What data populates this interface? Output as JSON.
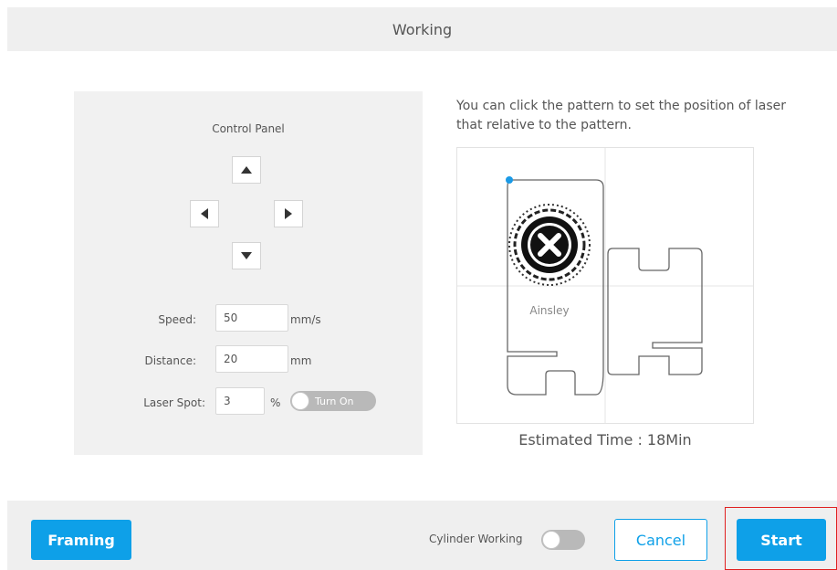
{
  "header": {
    "title": "Working"
  },
  "control_panel": {
    "title": "Control Panel",
    "speed": {
      "label": "Speed:",
      "value": "50",
      "unit": "mm/s"
    },
    "distance": {
      "label": "Distance:",
      "value": "20",
      "unit": "mm"
    },
    "laser_spot": {
      "label": "Laser Spot:",
      "value": "3",
      "unit": "%",
      "toggle_label": "Turn On"
    },
    "icons": {
      "up": "arrow-up-icon",
      "down": "arrow-down-icon",
      "left": "arrow-left-icon",
      "right": "arrow-right-icon"
    }
  },
  "preview": {
    "hint": "You can click the pattern to set the position of laser that relative to the pattern.",
    "name_text": "Ainsley",
    "estimated_time": "Estimated Time : 18Min"
  },
  "footer": {
    "framing_label": "Framing",
    "cylinder_label": "Cylinder Working",
    "cancel_label": "Cancel",
    "start_label": "Start"
  },
  "colors": {
    "accent": "#0ea0e8",
    "highlight": "#e02020",
    "panel_bg": "#f1f1f1"
  }
}
